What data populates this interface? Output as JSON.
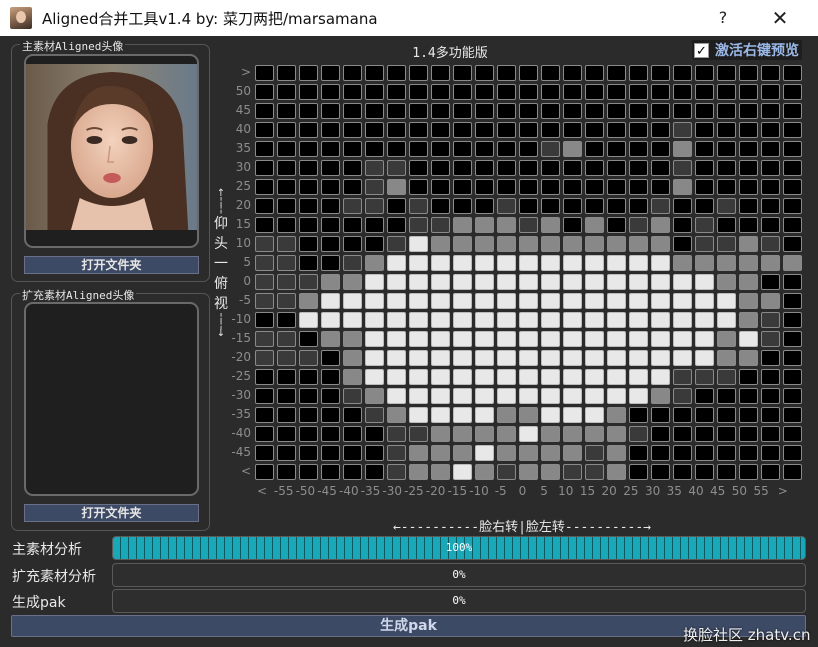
{
  "window": {
    "title": "Aligned合并工具v1.4  by: 菜刀两把/marsamana",
    "help_label": "?",
    "close_label": "✕",
    "icon": "app-portrait-icon"
  },
  "main_material": {
    "label": "主素材Aligned头像",
    "open_button": "打开文件夹"
  },
  "ext_material": {
    "label": "扩充素材Aligned头像",
    "open_button": "打开文件夹"
  },
  "version_label": "1.4多功能版",
  "preview": {
    "checked": true,
    "label": "激活右键预览"
  },
  "axes": {
    "vertical_chars": [
      "仰",
      "头",
      "一",
      "俯",
      "视"
    ],
    "horizontal": "←----------脸右转|脸左转----------→"
  },
  "grid": {
    "y_labels": [
      ">",
      "50",
      "45",
      "40",
      "35",
      "30",
      "25",
      "20",
      "15",
      "10",
      "5",
      "0",
      "-5",
      "-10",
      "-15",
      "-20",
      "-25",
      "-30",
      "-35",
      "-40",
      "-45",
      "<"
    ],
    "x_labels": [
      "<",
      "-55",
      "-50",
      "-45",
      "-40",
      "-35",
      "-30",
      "-25",
      "-20",
      "-15",
      "-10",
      "-5",
      "0",
      "5",
      "10",
      "15",
      "20",
      "25",
      "30",
      "35",
      "40",
      "45",
      "50",
      "55",
      ">"
    ],
    "legend": {
      "0": "#000000",
      "1": "#3a3a3a",
      "2": "#888888",
      "3": "#e8e8e8"
    },
    "rows": [
      "0000000000000000000000000",
      "0000000000000000000000000",
      "0000000000000000000000000",
      "0000000000000000000100000",
      "0000000000000120000200000",
      "0000011000000000000100000",
      "0000012000000000000200000",
      "0000110100010000001001000",
      "0000000112221202012010000",
      "1100001322222222222011210",
      "1100123333333333333222222",
      "1112233333333333333332200",
      "1123333333333333333333220",
      "0033333333333333333333210",
      "1102233333333333333332310",
      "1110233333333333333332200",
      "0000233333333333333111000",
      "0000123333333333332100000",
      "0000012333322333200000000",
      "0000001122223222210000000",
      "0000001222322221200000000",
      "0000001223212211200000000"
    ]
  },
  "progress_rows": [
    {
      "label": "主素材分析",
      "value": 100,
      "text": "100%"
    },
    {
      "label": "扩充素材分析",
      "value": 0,
      "text": "0%"
    },
    {
      "label": "生成pak",
      "value": 0,
      "text": "0%"
    }
  ],
  "generate_button": "生成pak",
  "watermark": "换脸社区 zhatv.cn"
}
